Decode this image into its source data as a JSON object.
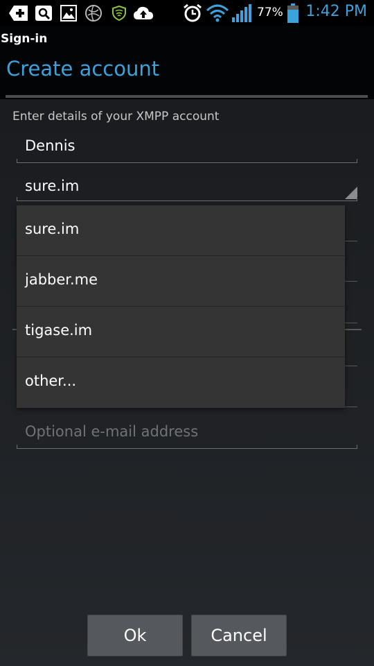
{
  "status_bar": {
    "icons": [
      "add-icon",
      "search-box-icon",
      "image-icon",
      "globe-icon",
      "shield-icon",
      "cloud-upload-icon",
      "alarm-icon",
      "wifi-icon",
      "signal-icon"
    ],
    "battery": "77%",
    "time": "1:42 PM",
    "colors": {
      "accent": "#3aa3de",
      "shield": "#8bc53f",
      "battery": "#3aa3de"
    }
  },
  "app": {
    "title": "Sign-in"
  },
  "dialog": {
    "title": "Create account",
    "instruction": "Enter details of your XMPP account",
    "username_value": "Dennis",
    "server_value": "sure.im",
    "email_placeholder": "Optional e-mail address",
    "ok_label": "Ok",
    "cancel_label": "Cancel"
  },
  "dropdown": {
    "items": [
      "sure.im",
      "jabber.me",
      "tigase.im",
      "other..."
    ]
  }
}
